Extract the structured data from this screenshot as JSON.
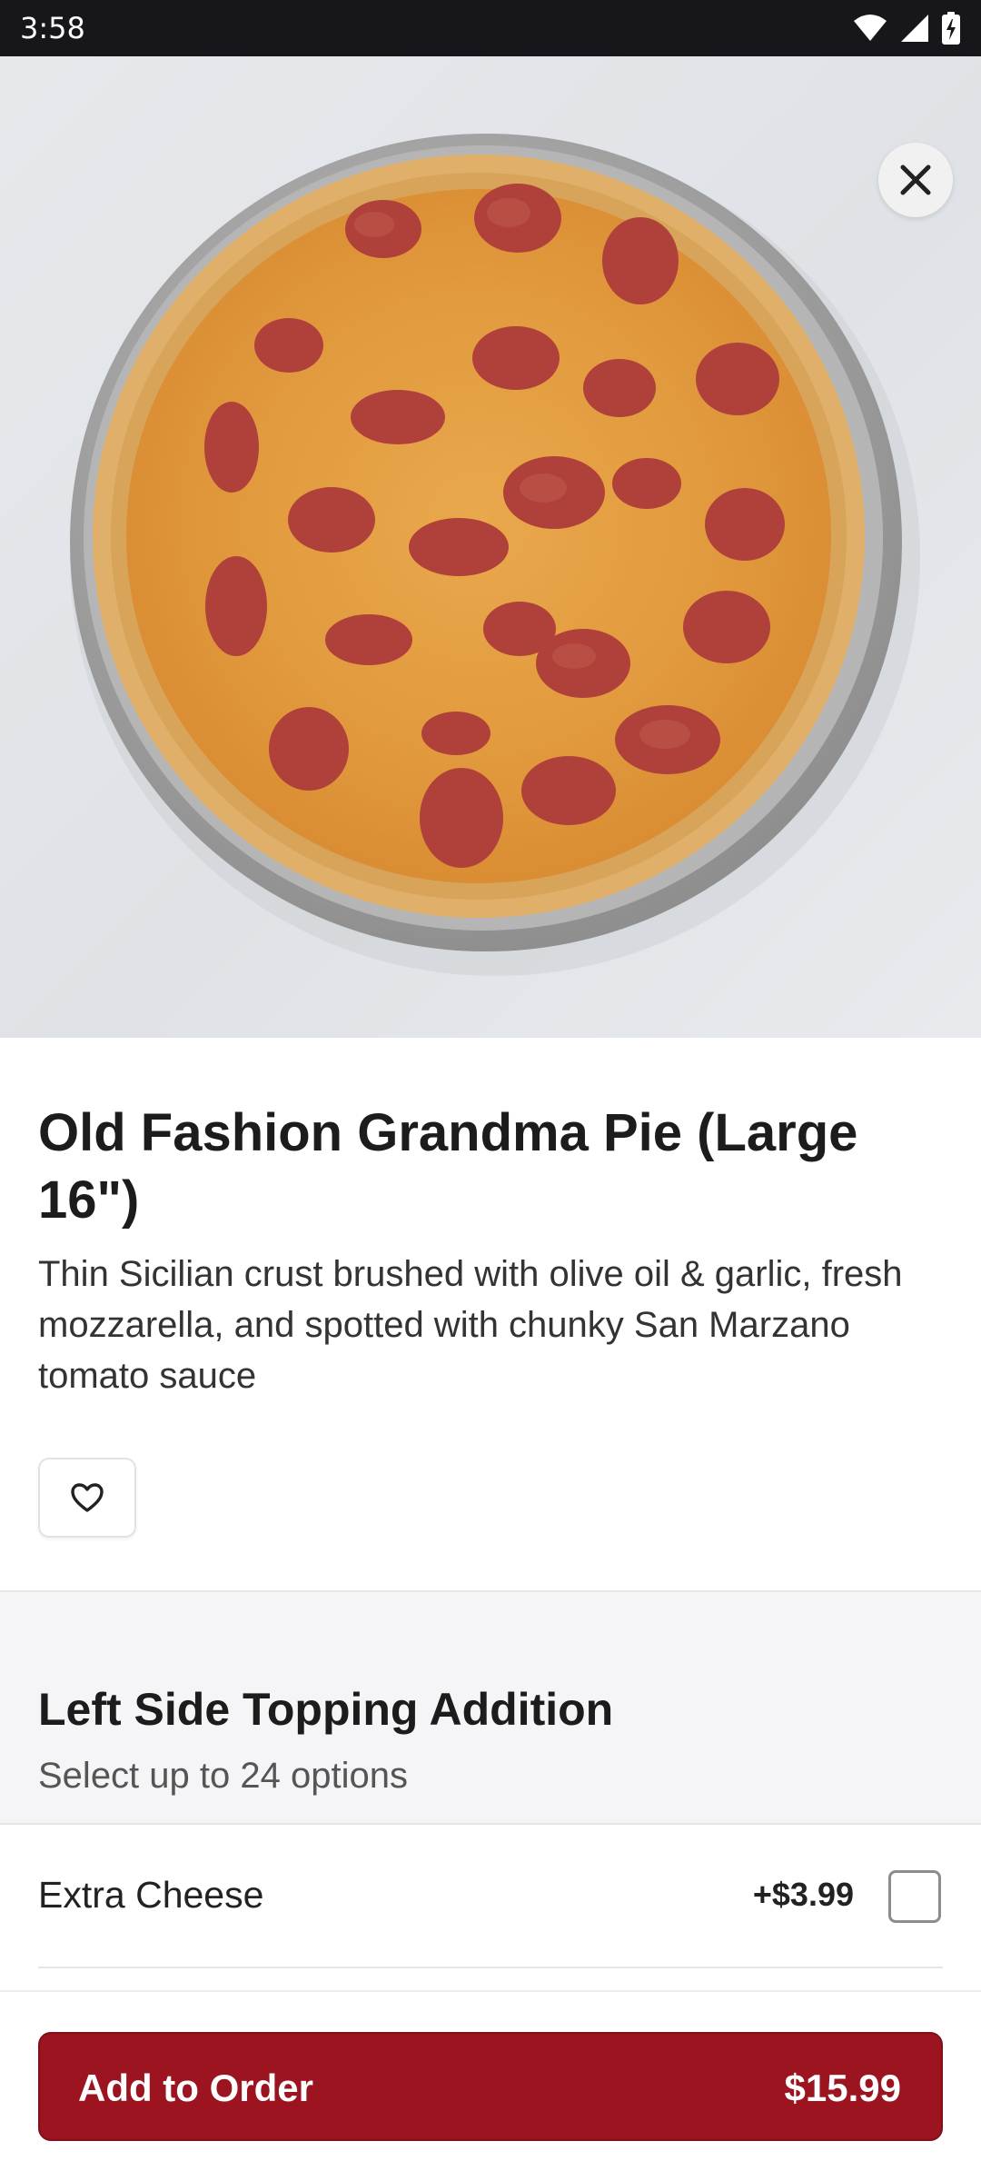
{
  "status_bar": {
    "time": "3:58",
    "icons": [
      "wifi-icon",
      "cellular-signal-icon",
      "battery-charging-icon"
    ]
  },
  "hero": {
    "image": "pizza-photo",
    "close_icon": "close-icon"
  },
  "item": {
    "title": "Old Fashion Grandma Pie (Large 16\")",
    "description": "Thin Sicilian crust brushed with olive oil & garlic, fresh mozzarella, and spotted with chunky San Marzano tomato sauce",
    "favorite_icon": "heart-icon"
  },
  "modifier_group": {
    "title": "Left Side Topping Addition",
    "subtitle": "Select up to 24 options",
    "options": [
      {
        "label": "Extra Cheese",
        "price": "+$3.99",
        "checked": false
      }
    ]
  },
  "cta": {
    "label": "Add to Order",
    "price": "$15.99"
  },
  "colors": {
    "accent": "#9b1420",
    "status_bar": "#17161b",
    "section_bg": "#f5f5f7"
  }
}
